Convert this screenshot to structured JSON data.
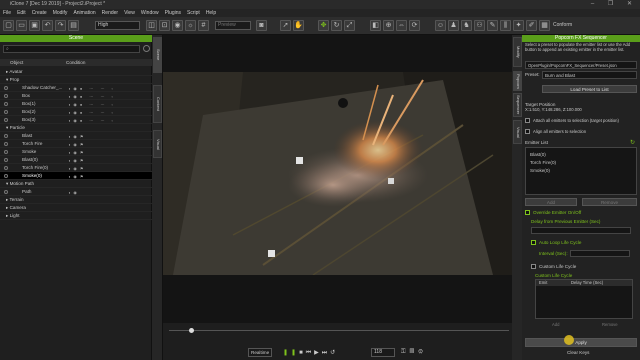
{
  "window": {
    "title": "iClone 7 [Dec 19 2019] - Project2.iProject *",
    "controls": "– ❐ ✕"
  },
  "menu": [
    "File",
    "Edit",
    "Create",
    "Modify",
    "Animation",
    "Render",
    "View",
    "Window",
    "Plugins",
    "Script",
    "Help"
  ],
  "toolbar": {
    "quality": "High",
    "camera": "Preview",
    "conform": "Conform"
  },
  "scene": {
    "title": "Scene",
    "search_placeholder": "",
    "col_object": "Object",
    "col_condition": "Condition",
    "rows": [
      {
        "label": "Avatar",
        "level": 0
      },
      {
        "label": "Prop",
        "level": 0
      },
      {
        "label": "Shadow Catcher_...",
        "level": 1
      },
      {
        "label": "Box",
        "level": 1
      },
      {
        "label": "Box(1)",
        "level": 1
      },
      {
        "label": "Box(2)",
        "level": 1
      },
      {
        "label": "Box(3)",
        "level": 1
      },
      {
        "label": "Particle",
        "level": 0
      },
      {
        "label": "Blast",
        "level": 1
      },
      {
        "label": "Torch Fire",
        "level": 1
      },
      {
        "label": "Smoke",
        "level": 1
      },
      {
        "label": "Blast(0)",
        "level": 1
      },
      {
        "label": "Torch Fire(0)",
        "level": 1
      },
      {
        "label": "Smoke(0)",
        "level": 1
      },
      {
        "label": "Motion Path",
        "level": 0
      },
      {
        "label": "Path",
        "level": 1
      },
      {
        "label": "Terrain",
        "level": 0
      },
      {
        "label": "Camera",
        "level": 0
      },
      {
        "label": "Light",
        "level": 0
      }
    ]
  },
  "side_tabs": [
    "Scene",
    "Content",
    "Visual"
  ],
  "right_tabs": [
    "Modify",
    "Popcorn",
    "Sequencer",
    "Visual"
  ],
  "panel": {
    "title": "Popcorn FX Sequencer",
    "description": "Select a preset to populate the emitter list or use the Add button to append an existing emitter in the emitter list.",
    "preset_path": "OpenPlugin/PopcornFX_Sequencer/Preset.json",
    "preset_label": "Preset:",
    "preset_value": "Burn and Blast",
    "load_button": "Load Preset to List",
    "target_label": "Target Position",
    "target_value": "X:1.510, Y:148.286, Z:100.000",
    "attach_label": "Attach all emitters to selection (target position)",
    "align_label": "Align all emitters to selection",
    "emitter_list_label": "Emitter List",
    "emitters": [
      "Blast(0)",
      "Torch Fire(0)",
      "Smoke(0)"
    ],
    "add_button": "Add",
    "remove_button": "Remove",
    "override_label": "Override Emitter On/Off",
    "delay_label": "Delay from Previous Emitter (Sec)",
    "loop_label": "Auto Loop Life Cycle",
    "interval_label": "Interval (Sec):",
    "custom_label": "Custom Life Cycle",
    "custom_list_label": "Custom Life Cycle",
    "col_emit": "Emit",
    "col_delay": "Delay Time (Sec)",
    "add2": "Add",
    "remove2": "Remove",
    "apply_button": "Apply",
    "clear_button": "Clear Keys"
  },
  "playback": {
    "mode": "Realtime",
    "frame": "118"
  }
}
